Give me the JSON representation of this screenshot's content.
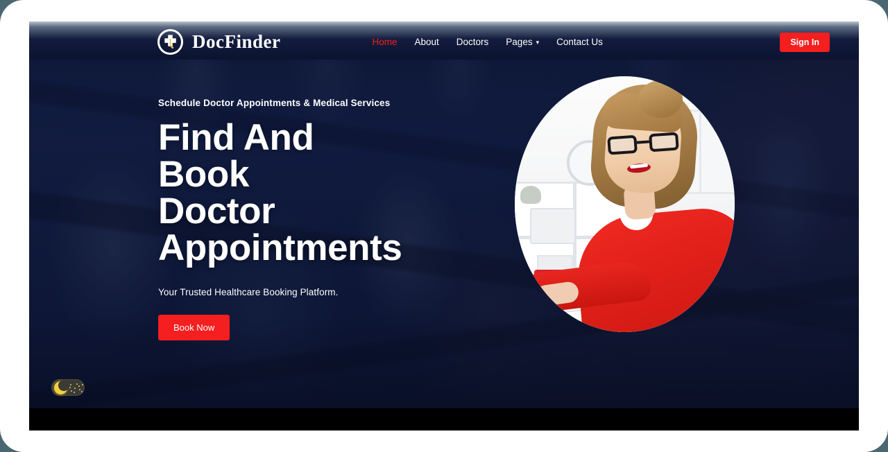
{
  "browser": {
    "outer_background_color": "#4a6671",
    "frame_color": "#ffffff"
  },
  "header": {
    "brand": {
      "name": "DocFinder",
      "logo_icon": "medical-cross-stethoscope-icon"
    },
    "nav": [
      {
        "label": "Home",
        "active": true,
        "has_dropdown": false
      },
      {
        "label": "About",
        "active": false,
        "has_dropdown": false
      },
      {
        "label": "Doctors",
        "active": false,
        "has_dropdown": false
      },
      {
        "label": "Pages",
        "active": false,
        "has_dropdown": true,
        "dropdown_icon": "chevron-down-icon"
      },
      {
        "label": "Contact Us",
        "active": false,
        "has_dropdown": false
      }
    ],
    "sign_in_label": "Sign In",
    "accent_color": "#f51f20",
    "background_color": "#0b1330"
  },
  "hero": {
    "eyebrow": "Schedule Doctor Appointments & Medical Services",
    "title": "Find And Book Doctor Appointments",
    "subtitle": "Your Trusted Healthcare Booking Platform.",
    "cta_label": "Book Now",
    "cta_color": "#f51f20",
    "portrait_alt": "smiling-female-doctor-in-red-blouse-at-desk"
  },
  "dark_mode_toggle": {
    "state": "off",
    "icon": "crescent-moon-icon",
    "knob_color": "#f3cf3d",
    "track_color": "#3b3a33"
  }
}
